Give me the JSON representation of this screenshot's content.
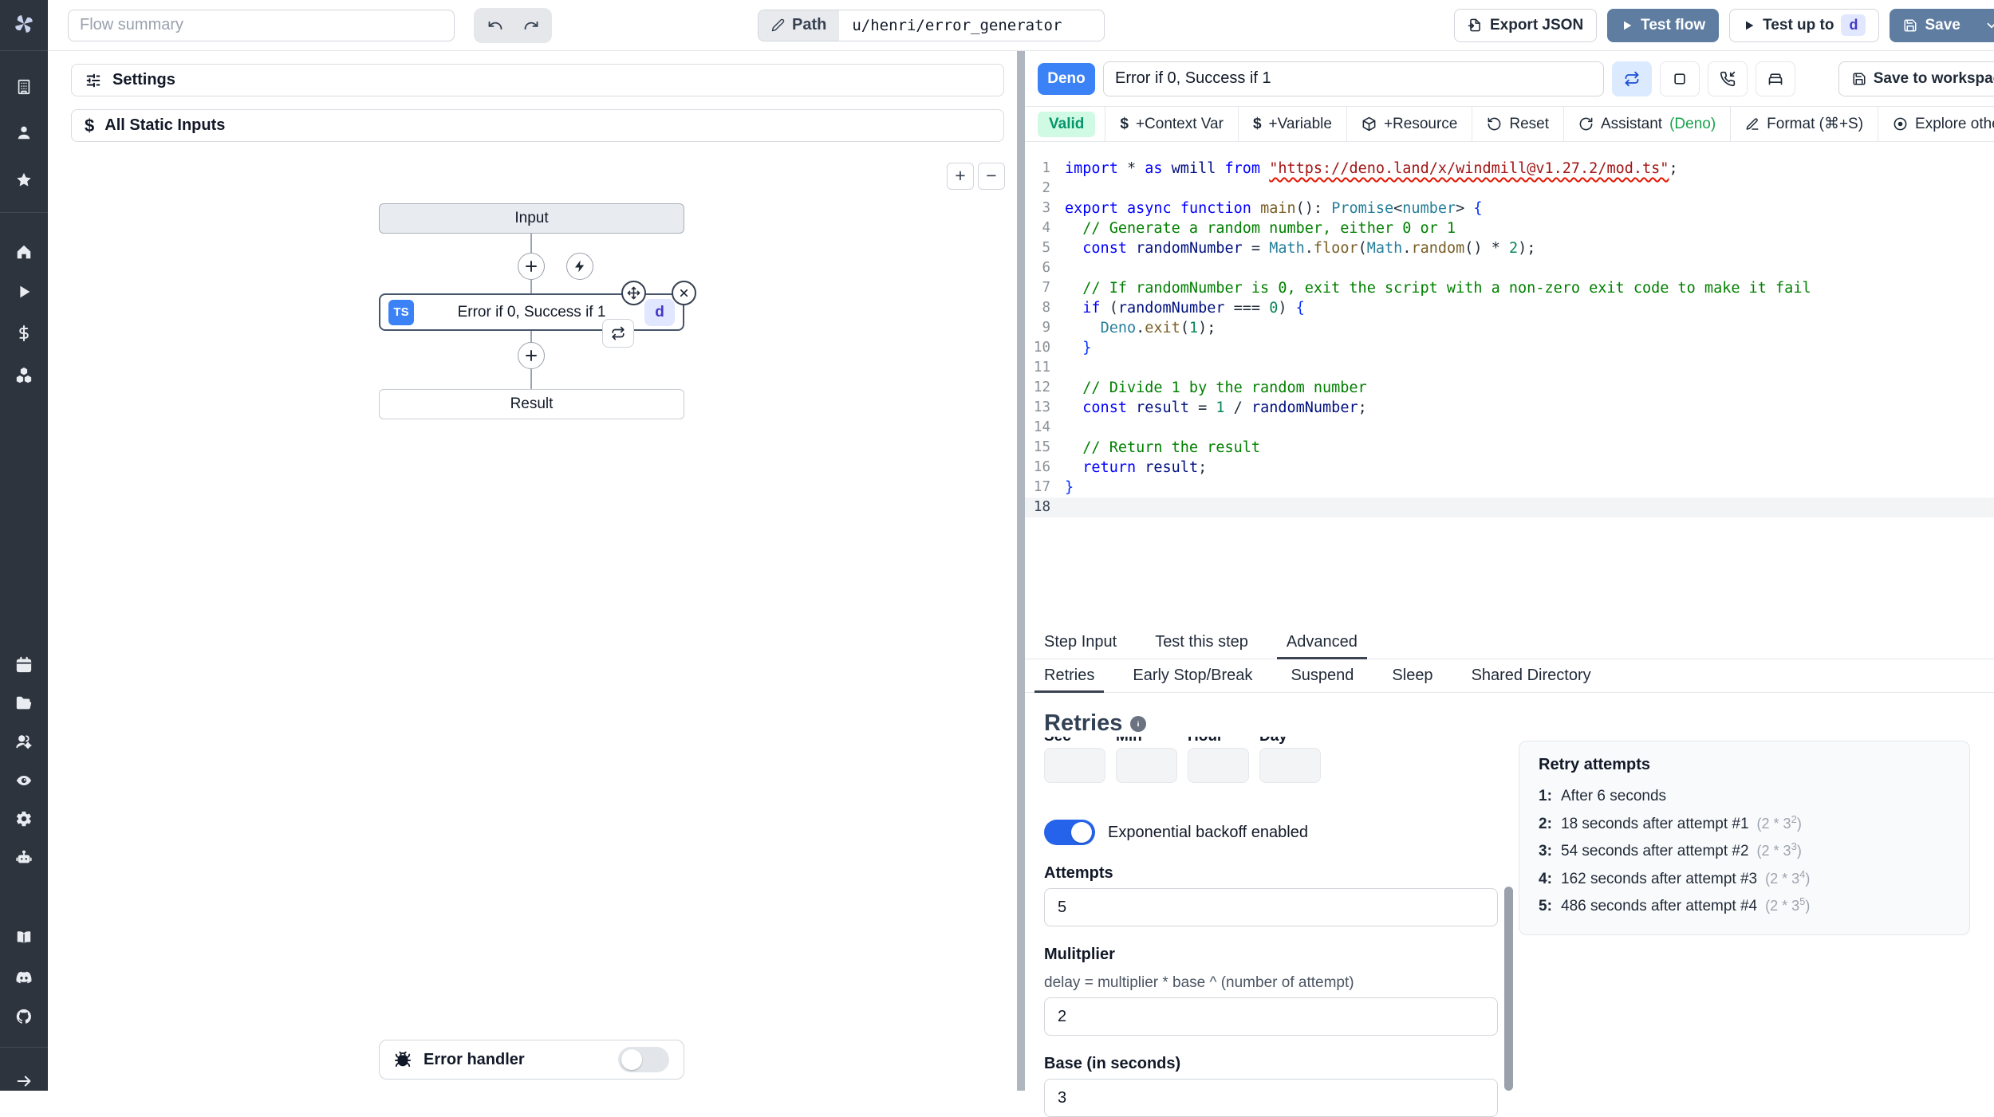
{
  "colors": {
    "sidebar_bg": "#2e343e",
    "primary_button": "#5e7da0",
    "accent_blue": "#3b82f6",
    "toggle_on": "#2563eb",
    "valid_bg": "#d1fae5",
    "valid_text": "#059669",
    "badge_indigo_bg": "#e0e7ff",
    "badge_indigo_text": "#4338ca",
    "assistant_green": "#16a34a"
  },
  "topbar": {
    "flow_summary_placeholder": "Flow summary",
    "path_label": "Path",
    "path_value": "u/henri/error_generator",
    "export_json_label": "Export JSON",
    "test_flow_label": "Test flow",
    "test_up_to_label": "Test up to",
    "test_up_to_badge": "d",
    "save_label": "Save"
  },
  "sidebar": {
    "icons": [
      "windmill-logo",
      "workspace",
      "user",
      "favorites",
      "home",
      "runs",
      "variables",
      "resources",
      "schedules",
      "folders",
      "groups",
      "audit-logs",
      "settings",
      "workers",
      "docs",
      "discord",
      "github",
      "collapse"
    ]
  },
  "flow_panel": {
    "settings_label": "Settings",
    "static_inputs_label": "All Static Inputs",
    "dollar_icon": "$",
    "zoom_in_label": "+",
    "zoom_out_label": "−",
    "input_node_label": "Input",
    "step_node": {
      "lang_badge": "TS",
      "title": "Error if 0, Success if 1",
      "id_badge": "d"
    },
    "result_node_label": "Result",
    "error_handler_label": "Error handler"
  },
  "editor": {
    "header": {
      "lang_badge": "Deno",
      "title_value": "Error if 0, Success if 1",
      "save_to_workspace_label": "Save to workspace"
    },
    "toolbar": {
      "valid_label": "Valid",
      "dollar_icon": "$",
      "context_var_label": "+Context Var",
      "variable_label": "+Variable",
      "resource_label": "+Resource",
      "reset_label": "Reset",
      "assistant_label": "Assistant",
      "assistant_lang": "(Deno)",
      "format_label": "Format (⌘+S)",
      "explore_label": "Explore other s"
    },
    "code": {
      "lines": [
        [
          [
            "kw",
            "import"
          ],
          [
            "pl",
            " * "
          ],
          [
            "kw",
            "as"
          ],
          [
            "pl",
            " "
          ],
          [
            "id",
            "wmill"
          ],
          [
            "pl",
            " "
          ],
          [
            "kw",
            "from"
          ],
          [
            "pl",
            " "
          ],
          [
            "st sq",
            "\"https://deno.land/x/windmill@v1.27.2/mod.ts\""
          ],
          [
            "pl",
            ";"
          ]
        ],
        [],
        [
          [
            "kw",
            "export"
          ],
          [
            "pl",
            " "
          ],
          [
            "kw",
            "async"
          ],
          [
            "pl",
            " "
          ],
          [
            "kw",
            "function"
          ],
          [
            "pl",
            " "
          ],
          [
            "fn",
            "main"
          ],
          [
            "pl",
            "(): "
          ],
          [
            "ty",
            "Promise"
          ],
          [
            "pl",
            "<"
          ],
          [
            "ty",
            "number"
          ],
          [
            "pl",
            "> "
          ],
          [
            "br",
            "{"
          ]
        ],
        [
          [
            "pl",
            "  "
          ],
          [
            "cm",
            "// Generate a random number, either 0 or 1"
          ]
        ],
        [
          [
            "pl",
            "  "
          ],
          [
            "kw",
            "const"
          ],
          [
            "pl",
            " "
          ],
          [
            "id",
            "randomNumber"
          ],
          [
            "pl",
            " = "
          ],
          [
            "ty",
            "Math"
          ],
          [
            "pl",
            "."
          ],
          [
            "fn",
            "floor"
          ],
          [
            "pl",
            "("
          ],
          [
            "ty",
            "Math"
          ],
          [
            "pl",
            "."
          ],
          [
            "fn",
            "random"
          ],
          [
            "pl",
            "() * "
          ],
          [
            "nu",
            "2"
          ],
          [
            "pl",
            ");"
          ]
        ],
        [],
        [
          [
            "pl",
            "  "
          ],
          [
            "cm",
            "// If randomNumber is 0, exit the script with a non-zero exit code to make it fail"
          ]
        ],
        [
          [
            "pl",
            "  "
          ],
          [
            "kw",
            "if"
          ],
          [
            "pl",
            " ("
          ],
          [
            "id",
            "randomNumber"
          ],
          [
            "pl",
            " === "
          ],
          [
            "nu",
            "0"
          ],
          [
            "pl",
            ") "
          ],
          [
            "br",
            "{"
          ]
        ],
        [
          [
            "pl",
            "    "
          ],
          [
            "ty",
            "Deno"
          ],
          [
            "pl",
            "."
          ],
          [
            "fn",
            "exit"
          ],
          [
            "pl",
            "("
          ],
          [
            "nu",
            "1"
          ],
          [
            "pl",
            ");"
          ]
        ],
        [
          [
            "pl",
            "  "
          ],
          [
            "br",
            "}"
          ]
        ],
        [],
        [
          [
            "pl",
            "  "
          ],
          [
            "cm",
            "// Divide 1 by the random number"
          ]
        ],
        [
          [
            "pl",
            "  "
          ],
          [
            "kw",
            "const"
          ],
          [
            "pl",
            " "
          ],
          [
            "id",
            "result"
          ],
          [
            "pl",
            " = "
          ],
          [
            "nu",
            "1"
          ],
          [
            "pl",
            " / "
          ],
          [
            "id",
            "randomNumber"
          ],
          [
            "pl",
            ";"
          ]
        ],
        [],
        [
          [
            "pl",
            "  "
          ],
          [
            "cm",
            "// Return the result"
          ]
        ],
        [
          [
            "pl",
            "  "
          ],
          [
            "kw",
            "return"
          ],
          [
            "pl",
            " "
          ],
          [
            "id",
            "result"
          ],
          [
            "pl",
            ";"
          ]
        ],
        [
          [
            "br",
            "}"
          ]
        ],
        []
      ]
    }
  },
  "panels": {
    "tabs": [
      "Step Input",
      "Test this step",
      "Advanced"
    ],
    "active_tab": "Advanced",
    "subtabs": [
      "Retries",
      "Early Stop/Break",
      "Suspend",
      "Sleep",
      "Shared Directory"
    ],
    "active_subtab": "Retries"
  },
  "retries": {
    "heading": "Retries",
    "time_labels": [
      "Sec",
      "Min",
      "Hour",
      "Day"
    ],
    "toggle_label": "Exponential backoff enabled",
    "attempts_label": "Attempts",
    "attempts_value": "5",
    "multiplier_label": "Mulitplier",
    "multiplier_help": "delay = multiplier * base ^ (number of attempt)",
    "multiplier_value": "2",
    "base_label": "Base (in seconds)",
    "base_value": "3"
  },
  "retry_attempts": {
    "title": "Retry attempts",
    "items": [
      {
        "n": "1:",
        "text": "After 6 seconds",
        "f_pre": "",
        "f_sup": "",
        "f_post": ""
      },
      {
        "n": "2:",
        "text": "18 seconds after attempt #1",
        "f_pre": "(2 * 3",
        "f_sup": "2",
        "f_post": ")"
      },
      {
        "n": "3:",
        "text": "54 seconds after attempt #2",
        "f_pre": "(2 * 3",
        "f_sup": "3",
        "f_post": ")"
      },
      {
        "n": "4:",
        "text": "162 seconds after attempt #3",
        "f_pre": "(2 * 3",
        "f_sup": "4",
        "f_post": ")"
      },
      {
        "n": "5:",
        "text": "486 seconds after attempt #4",
        "f_pre": "(2 * 3",
        "f_sup": "5",
        "f_post": ")"
      }
    ]
  }
}
